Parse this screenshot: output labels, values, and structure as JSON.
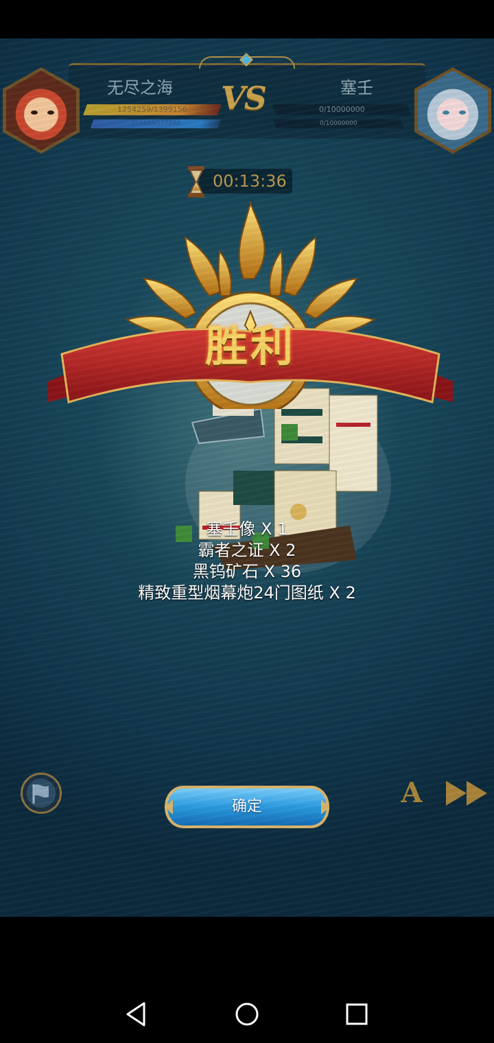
{
  "hud": {
    "player_name": "无尽之海",
    "opponent_name": "塞壬",
    "vs_label": "VS",
    "player_hp": "1254259/1399156",
    "player_mp": "165493/177890",
    "player_hp_fraction": 0.9,
    "player_mp_fraction": 0.93,
    "opponent_hp": "0/10000000",
    "opponent_mp": "0/10000000",
    "opponent_hp_fraction": 0,
    "timer": "00:13:36"
  },
  "result": {
    "title": "胜利"
  },
  "rewards": [
    "塞壬像 X 1",
    "霸者之证 X 2",
    "黑钨矿石 X 36",
    "精致重型烟幕炮24门图纸 X 2"
  ],
  "controls": {
    "confirm_label": "确定",
    "auto_label": "A"
  },
  "colors": {
    "banner_red": "#b8232a",
    "title_gold": "#f6d366",
    "sea": "#174457",
    "button_blue": "#2a9be0"
  },
  "icons": {
    "flag": "flag-icon",
    "hourglass": "hourglass-icon",
    "speed": "fast-forward-icon",
    "nav_back": "back-triangle-icon",
    "nav_home": "home-circle-icon",
    "nav_recents": "recents-square-icon"
  }
}
